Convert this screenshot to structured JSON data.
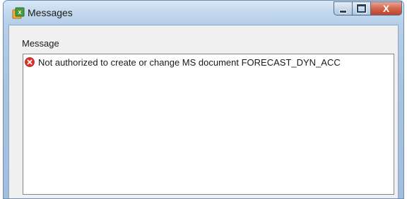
{
  "window": {
    "title": "Messages",
    "app_icon": "sap-app-icon",
    "controls": {
      "minimize_icon": "minimize-icon",
      "maximize_icon": "maximize-icon",
      "close_glyph": "X"
    }
  },
  "content": {
    "group_label": "Message",
    "messages": [
      {
        "type": "error",
        "icon": "error-icon",
        "text": "Not authorized to create or change MS document FORECAST_DYN_ACC"
      }
    ]
  },
  "colors": {
    "error": "#d9342b",
    "close_button": "#c7472f"
  }
}
